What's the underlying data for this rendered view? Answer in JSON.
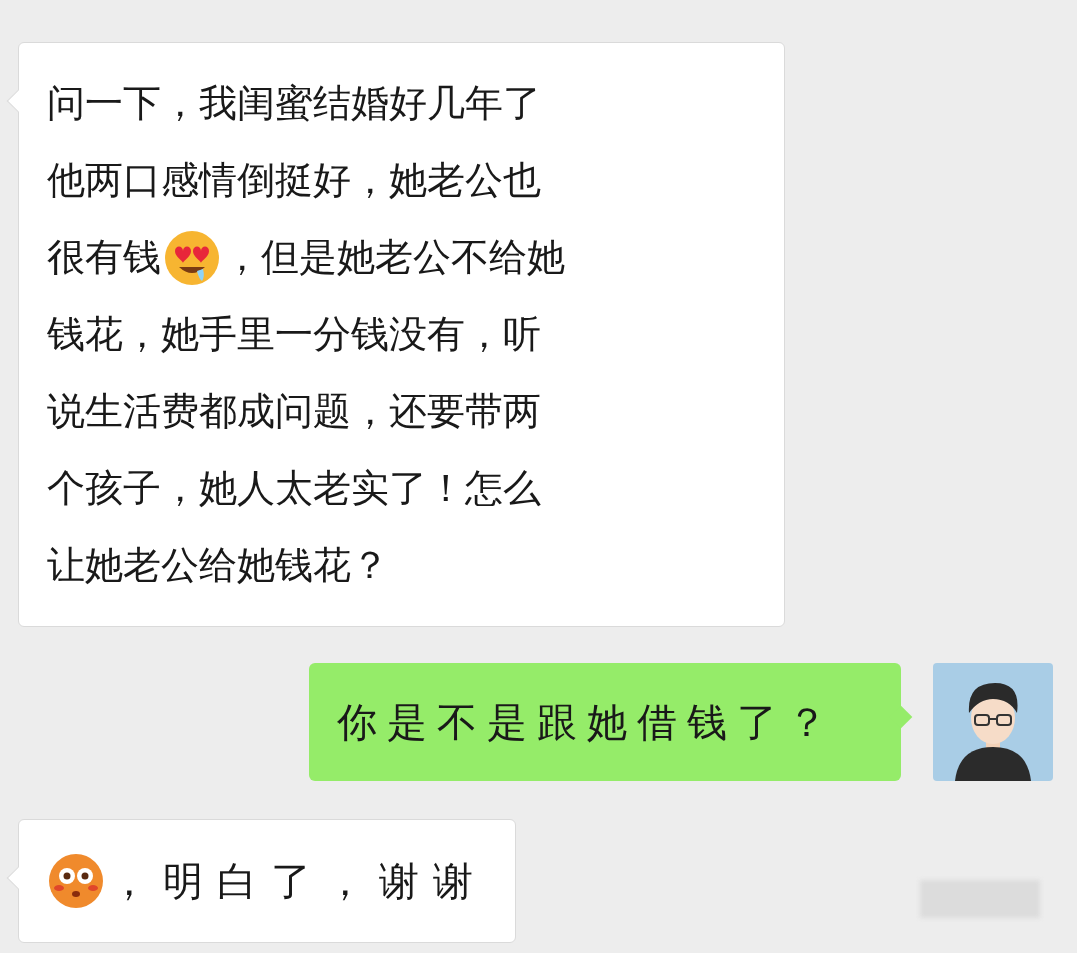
{
  "messages": [
    {
      "kind": "incoming",
      "lines": [
        [
          {
            "kind": "text",
            "text": "问一下，我闺蜜结婚好几年了"
          }
        ],
        [
          {
            "kind": "text",
            "text": "他两口感情倒挺好，她老公也"
          }
        ],
        [
          {
            "kind": "text",
            "text": "很有钱"
          },
          {
            "kind": "heart_eyes_emoji"
          },
          {
            "kind": "text",
            "text": "，但是她老公不给她"
          }
        ],
        [
          {
            "kind": "text",
            "text": "钱花，她手里一分钱没有，听"
          }
        ],
        [
          {
            "kind": "text",
            "text": "说生活费都成问题，还要带两"
          }
        ],
        [
          {
            "kind": "text",
            "text": "个孩子，她人太老实了！怎么"
          }
        ],
        [
          {
            "kind": "text",
            "text": "让她老公给她钱花？"
          }
        ]
      ]
    },
    {
      "kind": "outgoing",
      "lines": [
        [
          {
            "kind": "text",
            "text": "你是不是跟她借钱了？"
          }
        ]
      ]
    },
    {
      "kind": "incoming",
      "lines": [
        [
          {
            "kind": "flushed_emoji"
          },
          {
            "kind": "text",
            "text": "，明白了，谢谢"
          }
        ]
      ]
    }
  ]
}
